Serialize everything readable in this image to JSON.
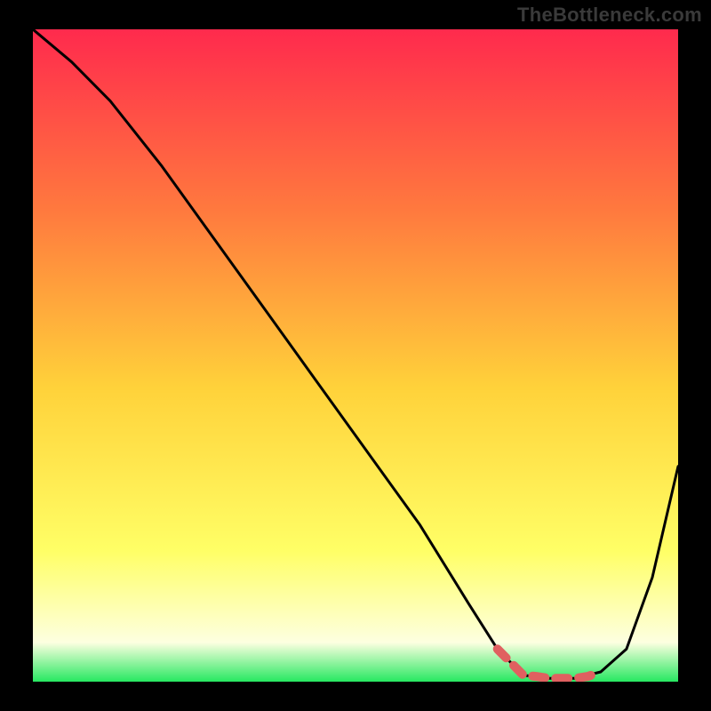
{
  "watermark": "TheBottleneck.com",
  "colors": {
    "bg": "#000000",
    "grad_top": "#ff2a4d",
    "grad_mid_upper": "#ff7a3e",
    "grad_mid": "#ffd23a",
    "grad_mid_lower": "#ffff66",
    "grad_near_bottom": "#fdffe0",
    "grad_bottom": "#27e861",
    "curve": "#000000",
    "highlight": "#e06060"
  },
  "chart_data": {
    "type": "line",
    "title": "",
    "xlabel": "",
    "ylabel": "",
    "xlim": [
      0,
      100
    ],
    "ylim": [
      0,
      100
    ],
    "series": [
      {
        "name": "bottleneck-curve",
        "x": [
          0,
          6,
          12,
          20,
          28,
          36,
          44,
          52,
          60,
          67.5,
          72,
          76,
          80,
          84,
          88,
          92,
          96,
          100
        ],
        "y": [
          100,
          95,
          89,
          79,
          68,
          57,
          46,
          35,
          24,
          12,
          5,
          1,
          0.5,
          0.5,
          1.5,
          5,
          16,
          33
        ]
      }
    ],
    "highlight_segment": {
      "x": [
        72,
        76,
        78,
        80,
        82,
        84,
        86,
        88
      ],
      "y": [
        5,
        1,
        0.8,
        0.5,
        0.5,
        0.5,
        0.8,
        1.5
      ]
    }
  }
}
